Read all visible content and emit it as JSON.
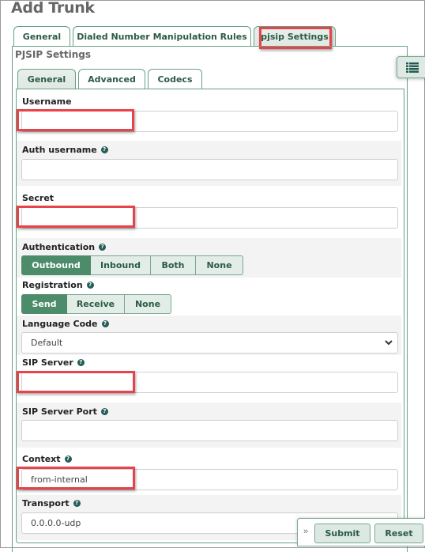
{
  "page": {
    "title": "Add Trunk"
  },
  "outer_tabs": [
    {
      "label": "General",
      "active": false
    },
    {
      "label": "Dialed Number Manipulation Rules",
      "active": false
    },
    {
      "label": "pjsip Settings",
      "active": true
    }
  ],
  "panel": {
    "title": "PJSIP Settings"
  },
  "inner_tabs": [
    {
      "label": "General",
      "active": true
    },
    {
      "label": "Advanced",
      "active": false
    },
    {
      "label": "Codecs",
      "active": false
    }
  ],
  "fields": {
    "username": {
      "label": "Username",
      "value": "",
      "help": false
    },
    "auth_username": {
      "label": "Auth username",
      "value": "",
      "help": true
    },
    "secret": {
      "label": "Secret",
      "value": "",
      "help": false
    },
    "authentication": {
      "label": "Authentication",
      "help": true,
      "options": [
        "Outbound",
        "Inbound",
        "Both",
        "None"
      ],
      "selected": "Outbound"
    },
    "registration": {
      "label": "Registration",
      "help": true,
      "options": [
        "Send",
        "Receive",
        "None"
      ],
      "selected": "Send"
    },
    "language_code": {
      "label": "Language Code",
      "help": true,
      "value": "Default"
    },
    "sip_server": {
      "label": "SIP Server",
      "value": "",
      "help": true
    },
    "sip_server_port": {
      "label": "SIP Server Port",
      "value": "",
      "help": true
    },
    "context": {
      "label": "Context",
      "value": "from-internal",
      "help": true
    },
    "transport": {
      "label": "Transport",
      "value": "0.0.0.0-udp",
      "help": true
    }
  },
  "help_glyph": "?",
  "actions": {
    "expand_glyph": "»",
    "submit": "Submit",
    "reset": "Reset"
  },
  "icons": {
    "side_toggle": "list-icon"
  },
  "colors": {
    "accent": "#4c8c6a",
    "tab_text": "#2b5b46",
    "highlight": "#e8434a"
  }
}
